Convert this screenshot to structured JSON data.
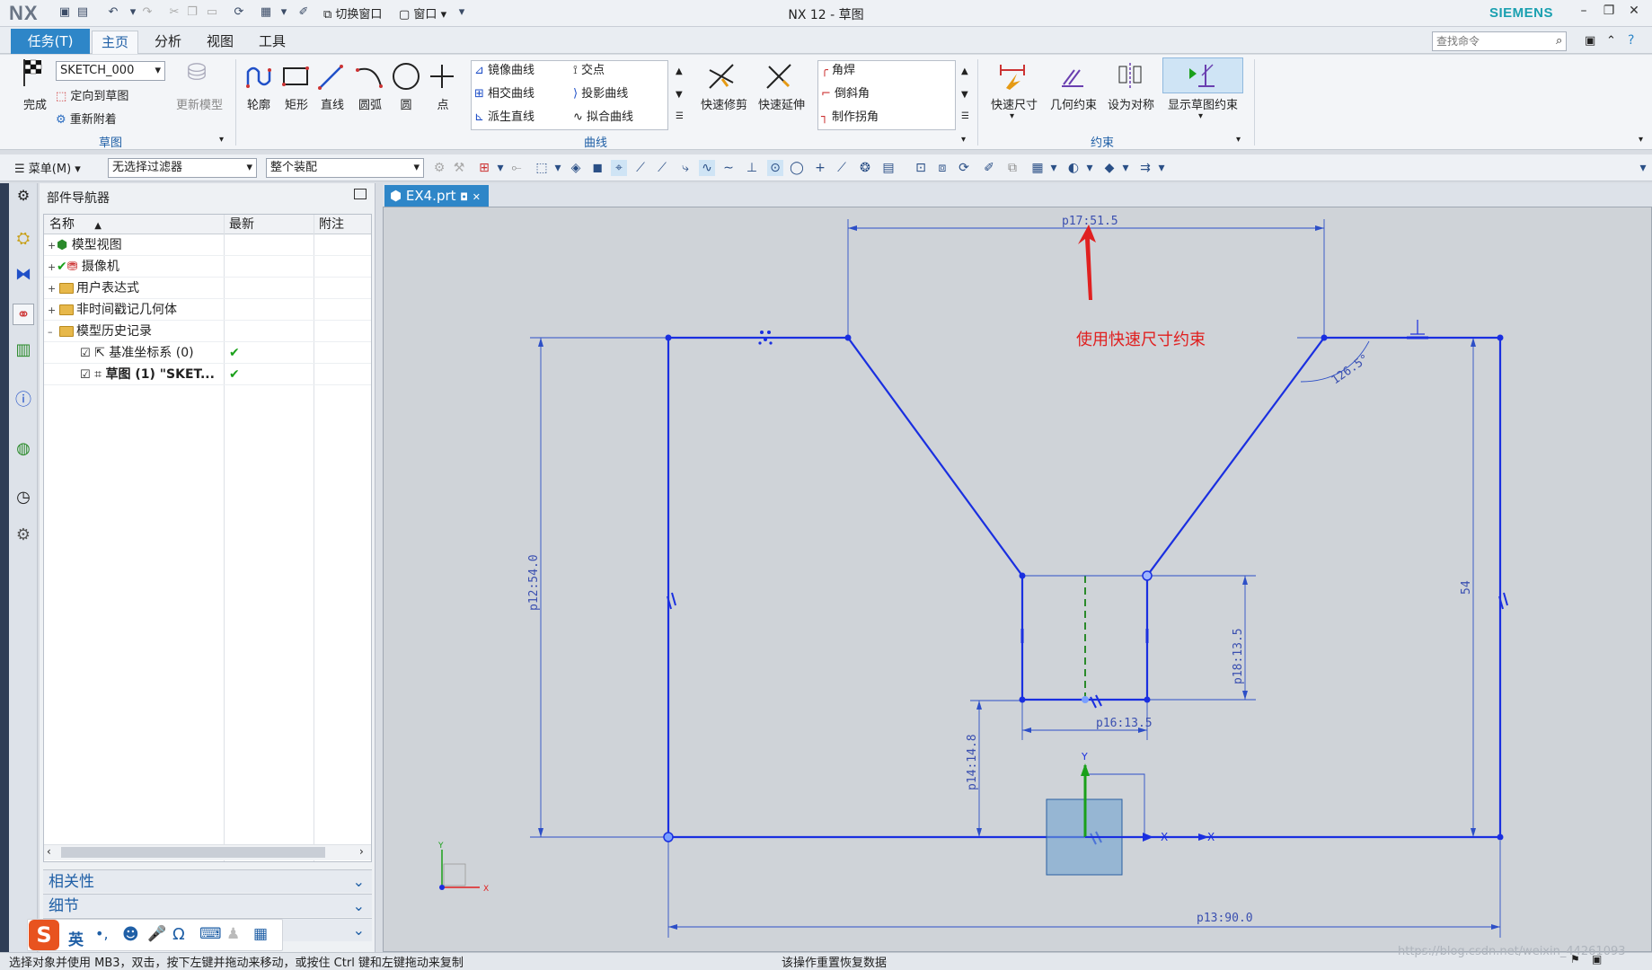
{
  "app": {
    "logo": "NX",
    "title": "NX 12 - 草图",
    "vendor": "SIEMENS"
  },
  "quick_access": {
    "switch_window": "切换窗口",
    "window": "窗口"
  },
  "tabs": [
    {
      "label": "任务(T)"
    },
    {
      "label": "主页"
    },
    {
      "label": "分析"
    },
    {
      "label": "视图"
    },
    {
      "label": "工具"
    }
  ],
  "search": {
    "placeholder": "查找命令"
  },
  "ribbon": {
    "sketch_group": {
      "finish": "完成",
      "sketch_name": "SKETCH_000",
      "orient": "定向到草图",
      "reattach": "重新附着",
      "update_model": "更新模型",
      "label": "草图"
    },
    "curve_group": {
      "profile": "轮廓",
      "rectangle": "矩形",
      "line": "直线",
      "arc": "圆弧",
      "circle": "圆",
      "point": "点",
      "mirror": "镜像曲线",
      "intersect_curve": "相交曲线",
      "derived_line": "派生直线",
      "intersection": "交点",
      "project": "投影曲线",
      "fit": "拟合曲线",
      "quick_trim": "快速修剪",
      "quick_extend": "快速延伸",
      "fillet": "角焊",
      "chamfer": "倒斜角",
      "make_corner": "制作拐角",
      "label": "曲线"
    },
    "constraint_group": {
      "rapid_dim": "快速尺寸",
      "geo_con": "几何约束",
      "symmetric": "设为对称",
      "show_con": "显示草图约束",
      "label": "约束"
    }
  },
  "toolbar2": {
    "menu": "菜单(M)",
    "filter": "无选择过滤器",
    "scope": "整个装配"
  },
  "navigator": {
    "title": "部件导航器",
    "columns": [
      "名称",
      "最新",
      "附注"
    ],
    "rows": [
      {
        "label": "模型视图",
        "latest": "",
        "note": ""
      },
      {
        "label": "摄像机",
        "latest": "",
        "note": ""
      },
      {
        "label": "用户表达式",
        "latest": "",
        "note": ""
      },
      {
        "label": "非时间戳记几何体",
        "latest": "",
        "note": ""
      },
      {
        "label": "模型历史记录",
        "latest": "",
        "note": ""
      },
      {
        "label": "基准坐标系 (0)",
        "latest": "✔",
        "note": ""
      },
      {
        "label": "草图 (1) \"SKET...",
        "latest": "✔",
        "note": ""
      }
    ],
    "panels": [
      "相关性",
      "细节"
    ]
  },
  "document": {
    "tab": "EX4.prt"
  },
  "sketch": {
    "annotation": "使用快速尺寸约束",
    "dims": {
      "p17": "p17:51.5",
      "p12": "p12:54.0",
      "p18": "p18:13.5",
      "p16": "p16:13.5",
      "p14": "p14:14.8",
      "p13": "p13:90.0",
      "d54": "54",
      "angle": "126.5°"
    },
    "axis": {
      "x": "X",
      "y": "Y"
    }
  },
  "ime": {
    "lang": "英"
  },
  "status": {
    "left": "选择对象并使用 MB3，双击，按下左键并拖动来移动，或按住 Ctrl 键和左键拖动来复制",
    "center": "该操作重置恢复数据",
    "watermark": "https://blog.csdn.net/weixin_44261093"
  }
}
